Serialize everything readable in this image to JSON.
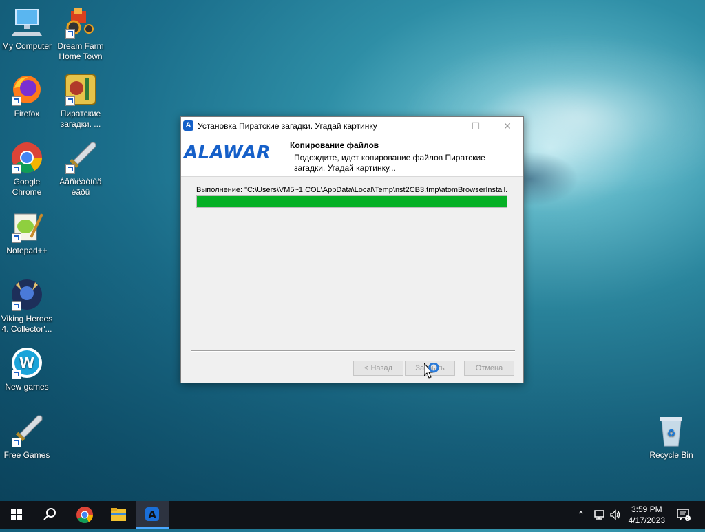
{
  "desktop": {
    "icons": [
      {
        "label": "My Computer"
      },
      {
        "label": "Dream Farm Home Town"
      },
      {
        "label": "Firefox"
      },
      {
        "label": "Пиратские загадки. ..."
      },
      {
        "label": "Google Chrome"
      },
      {
        "label": "Áåñïëàòíûå èãðû"
      },
      {
        "label": "Notepad++"
      },
      {
        "label": "Viking Heroes 4. Collector'..."
      },
      {
        "label": "New games"
      },
      {
        "label": "Free Games"
      },
      {
        "label": "Recycle Bin"
      }
    ]
  },
  "dialog": {
    "title": "Установка Пиратские загадки. Угадай картинку",
    "logo_text": "ALAWAR",
    "header_title": "Копирование файлов",
    "header_subtitle": "Подождите, идет копирование файлов Пиратские загадки. Угадай картинку...",
    "progress_text": "Выполнение: \"C:\\Users\\VM5~1.COL\\AppData\\Local\\Temp\\nst2CB3.tmp\\atomBrowserInstall.e",
    "progress_fraction": 1.0,
    "buttons": {
      "back": "< Назад",
      "close": "Закрыть",
      "cancel": "Отмена"
    },
    "window_buttons": {
      "minimize": "—",
      "maximize": "☐",
      "close": "✕"
    }
  },
  "taskbar": {
    "time": "3:59 PM",
    "date": "4/17/2023"
  },
  "colors": {
    "brand": "#1660c9",
    "progress": "#06b025"
  }
}
